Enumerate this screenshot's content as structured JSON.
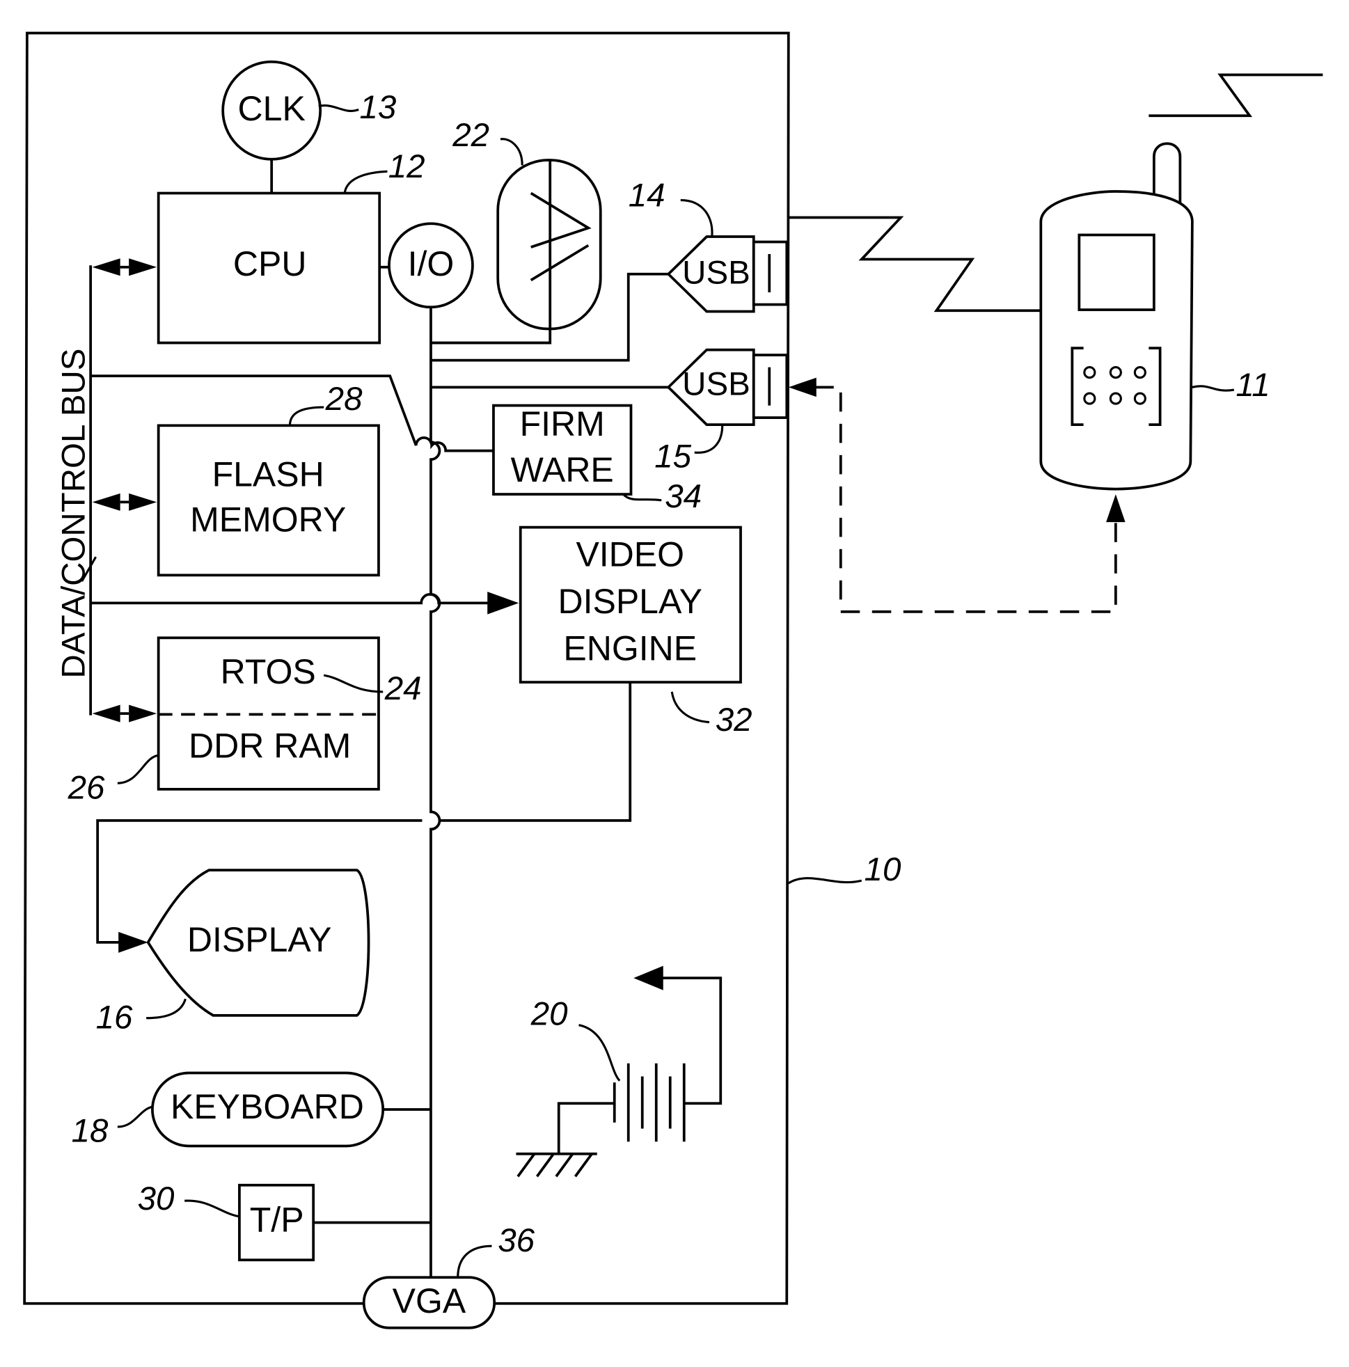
{
  "diagram": {
    "blocks": {
      "clk": {
        "label": "CLK",
        "ref": "13"
      },
      "cpu": {
        "label": "CPU",
        "ref": "12"
      },
      "io": {
        "label": "I/O"
      },
      "antenna_module": {
        "ref": "22"
      },
      "usb_top": {
        "label": "USB",
        "ref": "14"
      },
      "usb_bottom": {
        "label": "USB",
        "ref": "15"
      },
      "flash": {
        "line1": "FLASH",
        "line2": "MEMORY",
        "ref": "28"
      },
      "firmware": {
        "line1": "FIRM",
        "line2": "WARE",
        "ref": "34"
      },
      "video": {
        "line1": "VIDEO",
        "line2": "DISPLAY",
        "line3": "ENGINE",
        "ref": "32"
      },
      "rtos": {
        "label": "RTOS",
        "ref": "24"
      },
      "ddr": {
        "label": "DDR RAM",
        "ref": "26"
      },
      "display": {
        "label": "DISPLAY",
        "ref": "16"
      },
      "keyboard": {
        "label": "KEYBOARD",
        "ref": "18"
      },
      "tp": {
        "label": "T/P",
        "ref": "30"
      },
      "vga": {
        "label": "VGA",
        "ref": "36"
      },
      "battery": {
        "ref": "20"
      },
      "device": {
        "ref": "10"
      },
      "phone": {
        "ref": "11"
      }
    },
    "bus_label": "DATA/CONTROL BUS"
  }
}
